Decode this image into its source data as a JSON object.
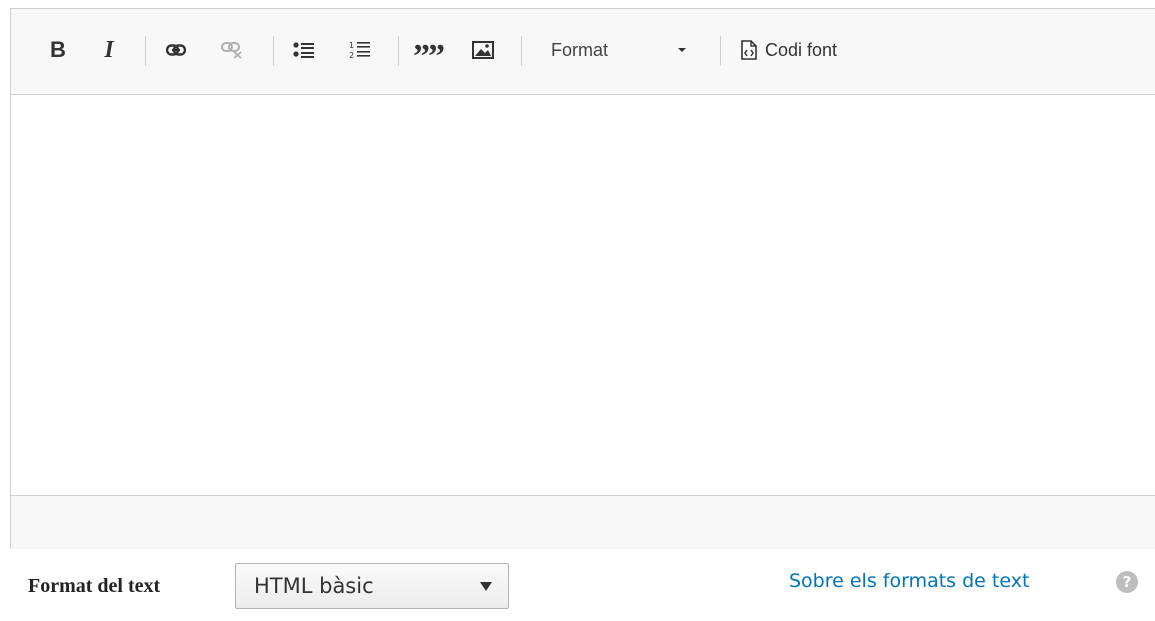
{
  "toolbar": {
    "bold": "B",
    "italic": "I",
    "format_label": "Format",
    "source_label": "Codi font",
    "icons": [
      "bold-icon",
      "italic-icon",
      "link-icon",
      "unlink-icon",
      "bulleted-list-icon",
      "numbered-list-icon",
      "blockquote-icon",
      "image-icon",
      "format-dropdown-icon",
      "source-code-icon"
    ]
  },
  "footer": {
    "label": "Format del text",
    "select_value": "HTML bàsic",
    "help_link": "Sobre els formats de text",
    "help_icon": "?"
  },
  "colors": {
    "link": "#0074bd",
    "border": "#d1d1d1",
    "toolbar_bg": "#f8f8f8"
  }
}
